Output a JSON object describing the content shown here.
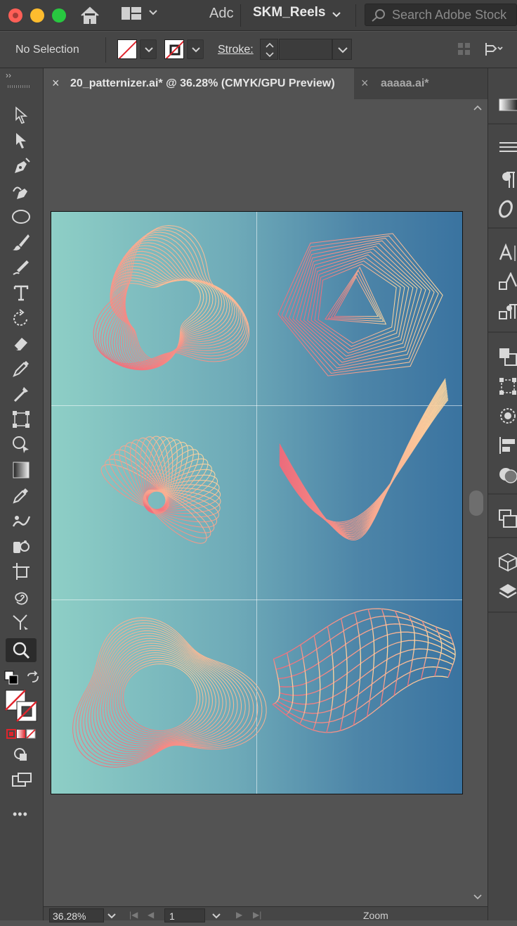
{
  "titlebar": {
    "app_short": "Adc",
    "document_switcher": "SKM_Reels",
    "search_placeholder": "Search Adobe Stock"
  },
  "control_bar": {
    "selection_status": "No Selection",
    "stroke_label": "Stroke:",
    "stroke_value": ""
  },
  "tabs": [
    {
      "label": "20_patternizer.ai* @ 36.28% (CMYK/GPU Preview)",
      "close": "×"
    },
    {
      "label": "aaaaa.ai*",
      "close": "×"
    }
  ],
  "toolbar": {
    "collapse": "››",
    "tools": [
      "selection-tool",
      "direct-selection-tool",
      "pen-tool",
      "curvature-tool",
      "ellipse-tool",
      "paintbrush-tool",
      "pencil-tool",
      "type-tool",
      "rotate-tool",
      "eraser-tool",
      "width-tool",
      "eyedropper-shaper-tool",
      "free-transform-tool",
      "shape-builder-tool",
      "gradient-tool",
      "eyedropper-tool",
      "puppet-warp-tool",
      "symbol-sprayer-tool",
      "artboard-tool",
      "twirl-tool",
      "mesh-tool",
      "zoom-tool"
    ],
    "more": "•••"
  },
  "artwork": {
    "gradient_colors": [
      "#8ecfc6",
      "#3a73a0"
    ],
    "line_colors": [
      "#f06a7a",
      "#ffd9a0"
    ]
  },
  "status_bar": {
    "zoom": "36.28%",
    "page": "1",
    "mode": "Zoom"
  }
}
